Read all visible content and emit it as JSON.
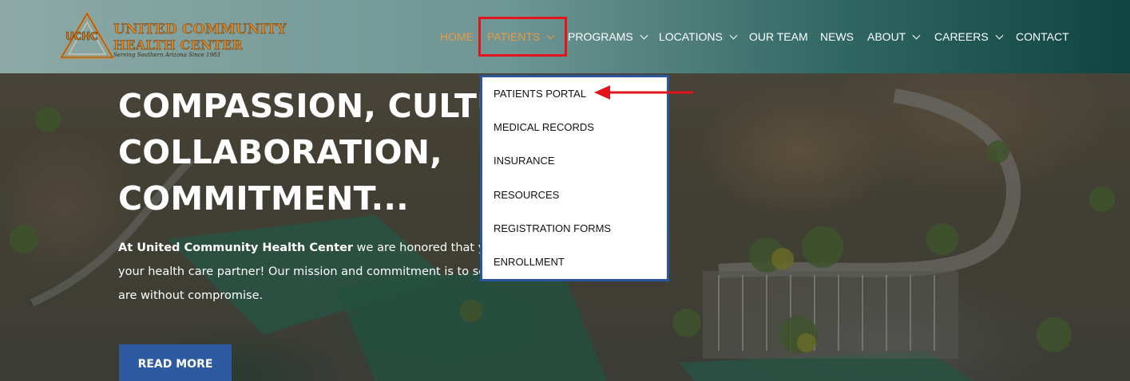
{
  "logo": {
    "abbr": "UCHC",
    "line1": "UNITED COMMUNITY",
    "line2": "HEALTH CENTER",
    "tagline": "Serving Southern Arizona Since 1983"
  },
  "nav": {
    "home": "HOME",
    "patients": "PATIENTS",
    "programs": "PROGRAMS",
    "locations": "LOCATIONS",
    "our_team": "OUR TEAM",
    "news": "NEWS",
    "about": "ABOUT",
    "careers": "CAREERS",
    "contact": "CONTACT"
  },
  "dropdown": {
    "items": [
      "PATIENTS PORTAL",
      "MEDICAL RECORDS",
      "INSURANCE",
      "RESOURCES",
      "REGISTRATION FORMS",
      "ENROLLMENT"
    ]
  },
  "hero": {
    "headline_lines": [
      "COMPASSION, CULTURE,",
      "COLLABORATION,",
      "COMMITMENT..."
    ],
    "para_bold": "At United Community Health Center",
    "para_line1_rest": " we are honored that you have",
    "para_line2": "your health care partner! Our mission and commitment is to serve you",
    "para_line3": "are without compromise.",
    "button": "READ MORE"
  },
  "colors": {
    "accent_orange": "#e79a4a",
    "highlight_red": "#e3141b",
    "dropdown_border": "#2a56a0",
    "button_blue": "#2d5aa0"
  }
}
